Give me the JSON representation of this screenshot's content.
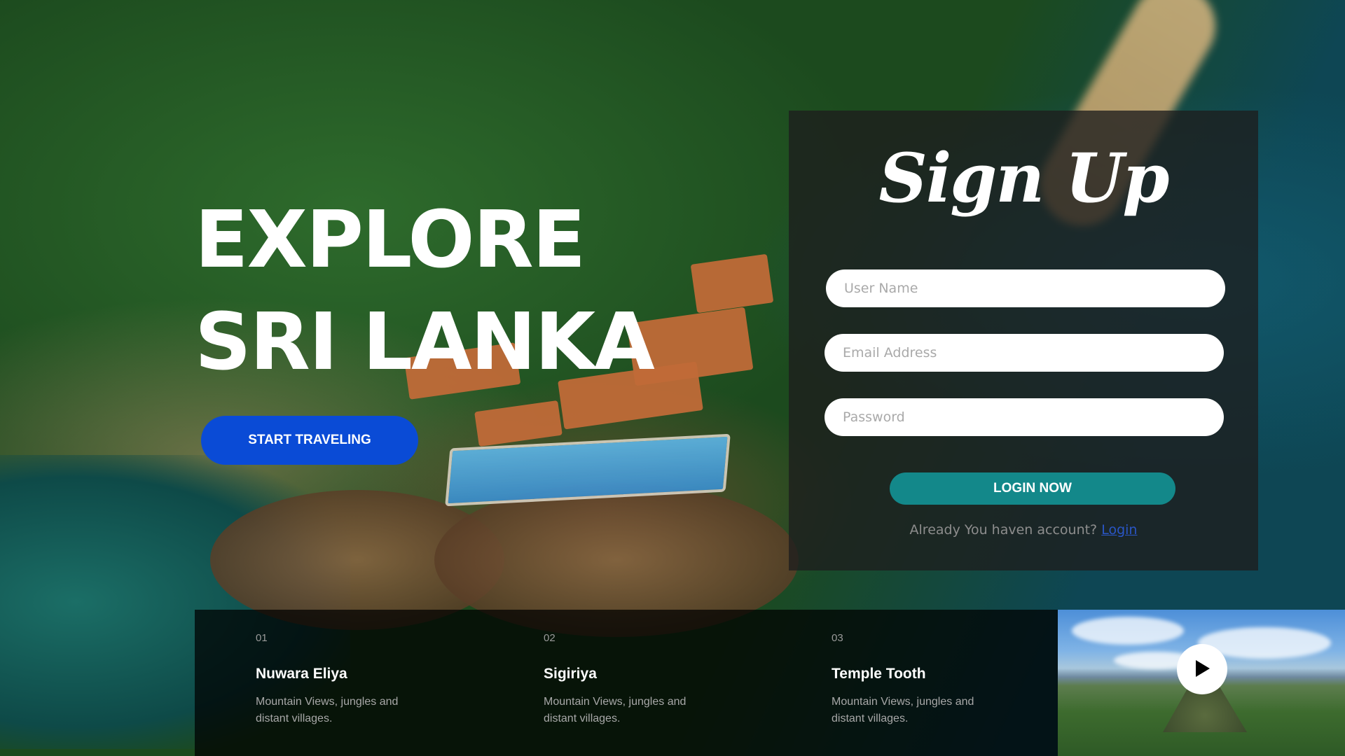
{
  "hero": {
    "title_line1": "EXPLORE",
    "title_line2": "SRI LANKA",
    "cta_label": "START TRAVELING"
  },
  "signup": {
    "title": "Sign Up",
    "username_placeholder": "User Name",
    "email_placeholder": "Email Address",
    "password_placeholder": "Password",
    "login_button": "LOGIN NOW",
    "account_prompt": "Already You haven account?",
    "login_link": "Login"
  },
  "destinations": [
    {
      "number": "01",
      "name": "Nuwara Eliya",
      "description": "Mountain Views, jungles and distant villages."
    },
    {
      "number": "02",
      "name": "Sigiriya",
      "description": "Mountain Views, jungles and distant villages."
    },
    {
      "number": "03",
      "name": "Temple Tooth",
      "description": "Mountain Views, jungles and distant villages."
    }
  ],
  "video": {
    "icon": "play-icon"
  },
  "colors": {
    "cta": "#0a4bd6",
    "login_button": "#13888a",
    "link": "#2a56c6",
    "panel": "rgba(30,30,30,0.78)"
  }
}
